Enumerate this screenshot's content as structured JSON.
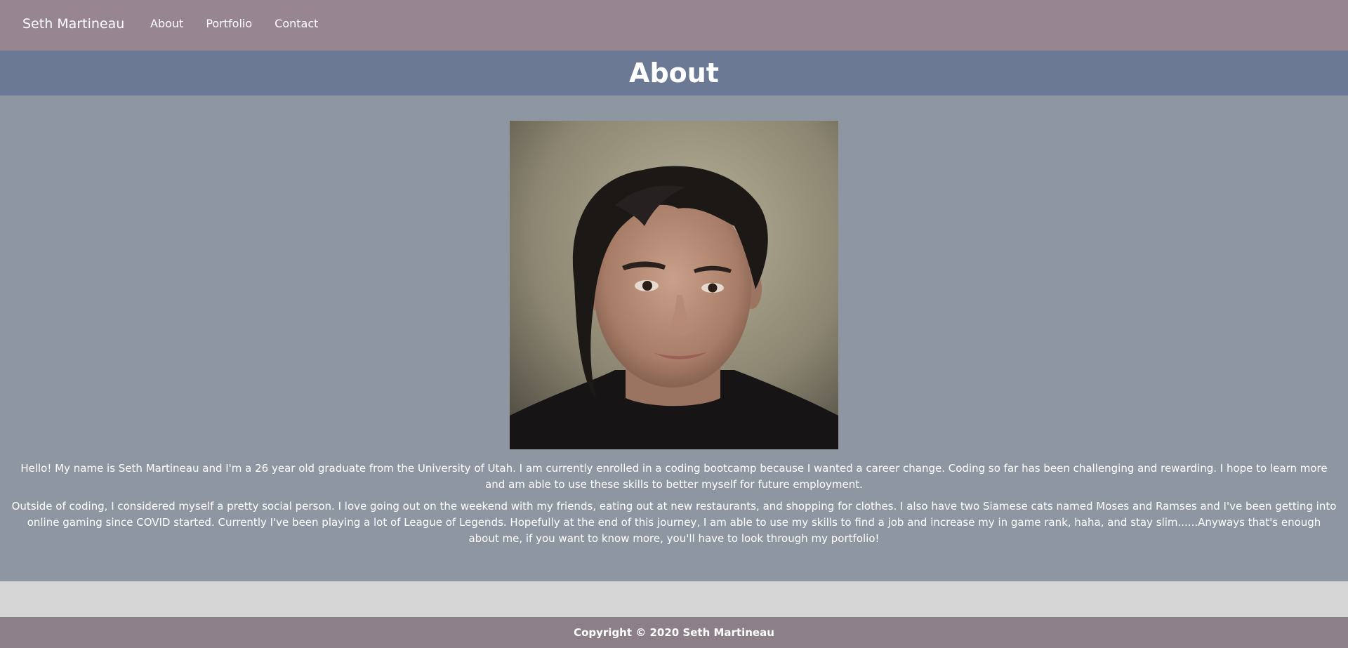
{
  "nav": {
    "brand": "Seth Martineau",
    "links": [
      "About",
      "Portfolio",
      "Contact"
    ]
  },
  "header": {
    "title": "About"
  },
  "about": {
    "photo_alt": "Photo of Seth Martineau",
    "paragraphs": [
      "Hello! My name is Seth Martineau and I'm a 26 year old graduate from the University of Utah. I am currently enrolled in a coding bootcamp because I wanted a career change. Coding so far has been challenging and rewarding. I hope to learn more and am able to use these skills to better myself for future employment.",
      "Outside of coding, I considered myself a pretty social person. I love going out on the weekend with my friends, eating out at new restaurants, and shopping for clothes. I also have two Siamese cats named Moses and Ramses and I've been getting into online gaming since COVID started. Currently I've been playing a lot of League of Legends. Hopefully at the end of this journey, I am able to use my skills to find a job and increase my in game rank, haha, and stay slim......Anyways that's enough about me, if you want to know more, you'll have to look through my portfolio!"
    ]
  },
  "footer": {
    "text": "Copyright © 2020 Seth Martineau"
  },
  "colors": {
    "navbar": "#978590",
    "title_bar": "#6c7994",
    "content_bg": "#8e97a1",
    "page_bg": "#d5d5d5",
    "footer": "#8d7f88"
  }
}
